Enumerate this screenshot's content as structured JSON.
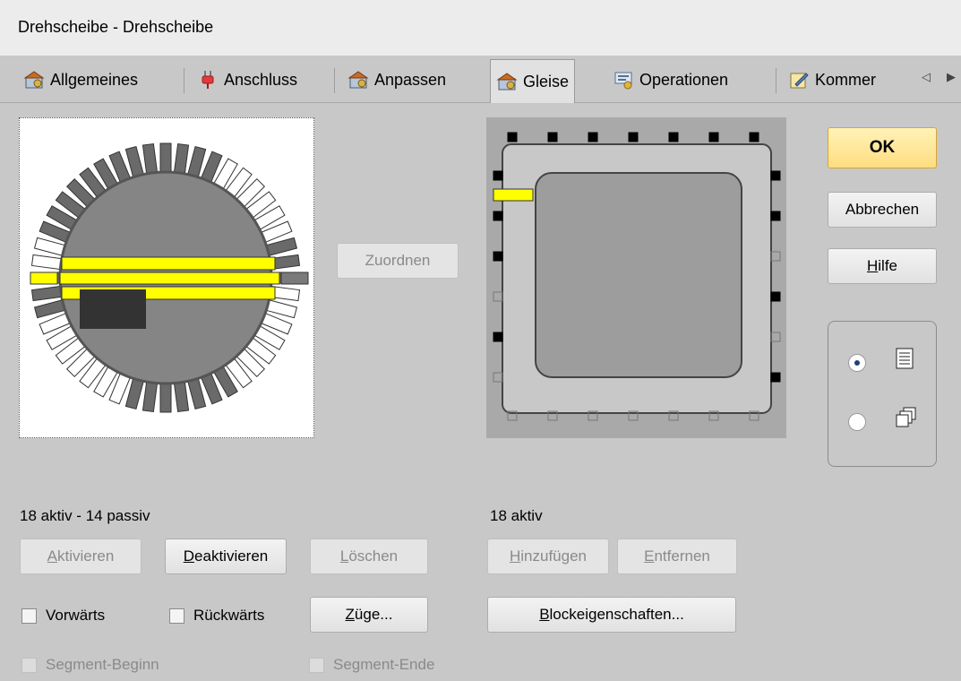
{
  "window": {
    "title": "Drehscheibe - Drehscheibe"
  },
  "tabs": [
    {
      "label": "Allgemeines",
      "icon": "gear-icon",
      "active": false
    },
    {
      "label": "Anschluss",
      "icon": "plug-icon",
      "active": false
    },
    {
      "label": "Anpassen",
      "icon": "gear-icon",
      "active": false
    },
    {
      "label": "Gleise",
      "icon": "gear-icon",
      "active": true
    },
    {
      "label": "Operationen",
      "icon": "operations-icon",
      "active": false
    },
    {
      "label": "Kommer",
      "icon": "edit-icon",
      "active": false
    }
  ],
  "buttons": {
    "ok": "OK",
    "cancel": "Abbrechen",
    "help_underlined": "H",
    "help_rest": "ilfe",
    "assign": "Zuordnen",
    "activate_u": "A",
    "activate_rest": "ktivieren",
    "deactivate_u": "D",
    "deactivate_rest": "eaktivieren",
    "delete_u": "L",
    "delete_rest": "öschen",
    "add_u": "H",
    "add_rest": "inzufügen",
    "remove_u": "E",
    "remove_rest": "ntfernen",
    "trains_u": "Z",
    "trains_rest": "üge...",
    "block_u": "B",
    "block_rest": "lockeigenschaften..."
  },
  "left_status": "18 aktiv - 14 passiv",
  "right_status": "18 aktiv",
  "checkboxes": {
    "forward": "Vorwärts",
    "backward": "Rückwärts",
    "segment_begin": "Segment-Beginn",
    "segment_end": "Segment-Ende"
  },
  "colors": {
    "track_highlight": "#ffff00",
    "ok_button": "#ffe08a"
  }
}
